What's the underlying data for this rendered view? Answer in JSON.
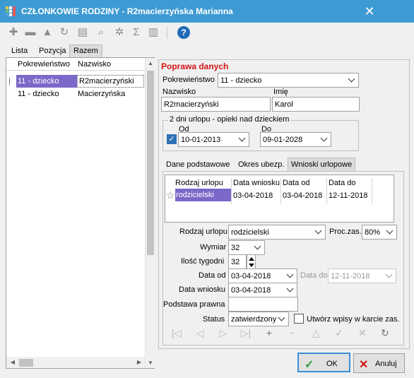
{
  "window": {
    "title": "CZŁONKOWIE RODZINY - R2macierzyńska Marianna",
    "icon": "app-icon",
    "close": "✕"
  },
  "toolbar": {
    "icons": [
      "plus-icon",
      "minus-icon",
      "filter-icon",
      "refresh-icon",
      "print-icon",
      "search-icon",
      "settings-icon",
      "sum-icon",
      "columns-icon",
      "help-icon"
    ],
    "help_label": "?"
  },
  "top_tabs": [
    {
      "label": "Lista"
    },
    {
      "label": "Pozycja"
    },
    {
      "label": "Razem",
      "active": true
    }
  ],
  "left_grid": {
    "columns": [
      "Pokrewieństwo",
      "Nazwisko"
    ],
    "rows": [
      {
        "pokrewienstwo": "11 - dziecko",
        "nazwisko": "R2macierzyński",
        "selected": true
      },
      {
        "pokrewienstwo": "11 - dziecko",
        "nazwisko": "Macierzyńska",
        "selected": false
      }
    ]
  },
  "form": {
    "section_title": "Poprawa danych",
    "pokrewienstwo_label": "Pokrewieństwo",
    "pokrewienstwo_value": "11 - dziecko",
    "nazwisko_label": "Nazwisko",
    "nazwisko_value": "R2macierzyński",
    "imie_label": "Imię",
    "imie_value": "Karol",
    "urlop_group_title": "2 dni urlopu - opieki nad dzieckiem",
    "od_label": "Od",
    "od_value": "10-01-2013",
    "od_checked": true,
    "do_label": "Do",
    "do_value": "09-01-2028"
  },
  "inner_tabs": [
    {
      "label": "Dane podstawowe"
    },
    {
      "label": "Okres ubezp."
    },
    {
      "label": "Wnioski urlopowe",
      "active": true
    }
  ],
  "leave_grid": {
    "columns": [
      "Rodzaj urlopu",
      "Data wniosku",
      "Data od",
      "Data do"
    ],
    "rows": [
      {
        "rodzaj": "rodzicielski",
        "data_wniosku": "03-04-2018",
        "data_od": "03-04-2018",
        "data_do": "12-11-2018"
      }
    ],
    "row_marker": "☆"
  },
  "leave_form": {
    "rodzaj_label": "Rodzaj urlopu",
    "rodzaj_value": "rodzicielski",
    "proc_label": "Proc.zas.",
    "proc_value": "80%",
    "wymiar_label": "Wymiar",
    "wymiar_value": "32",
    "tygodni_label": "Ilość tygodni",
    "tygodni_value": "32",
    "data_od_label": "Data od",
    "data_od_value": "03-04-2018",
    "data_do_label": "Data do",
    "data_do_value": "12-11-2018",
    "data_wniosku_label": "Data wniosku",
    "data_wniosku_value": "03-04-2018",
    "podstawa_label": "Podstawa prawna",
    "podstawa_value": "",
    "status_label": "Status",
    "status_value": "zatwierdzony",
    "utworz_label": "Utwórz wpisy w karcie zas.",
    "utworz_checked": false
  },
  "navigator": {
    "first": "|◁",
    "prev": "◁",
    "next": "▷",
    "last": "▷|",
    "add": "+",
    "delete": "−",
    "edit": "△",
    "post": "✓",
    "cancel": "✕",
    "refresh": "↻"
  },
  "buttons": {
    "ok_label": "OK",
    "cancel_label": "Anuluj"
  },
  "colors": {
    "titlebar": "#3e9ad3",
    "selection": "#7b68c8",
    "section_title": "#d21414",
    "ok_icon": "#2e9b3a",
    "cancel_icon": "#d21414",
    "checkbox": "#2f6fb6"
  }
}
